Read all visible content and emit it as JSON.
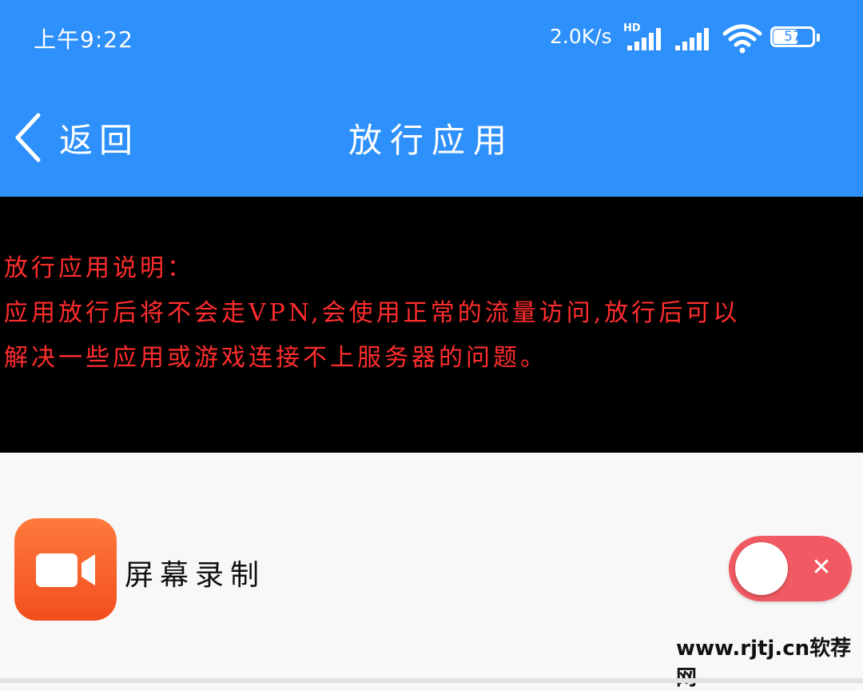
{
  "status_bar": {
    "time": "上午9:22",
    "net_speed": "2.0K/s",
    "network_type": "HD",
    "battery_level": "57"
  },
  "nav": {
    "back_label": "返回",
    "title": "放行应用"
  },
  "notice": {
    "lines": [
      "放行应用说明：",
      "应用放行后将不会走VPN,会使用正常的流量访问,放行后可以",
      "解决一些应用或游戏连接不上服务器的问题。"
    ],
    "text_color": "#ff2d2d"
  },
  "apps": [
    {
      "name": "屏幕录制",
      "icon": "video-camera-icon",
      "bypass_enabled": false
    }
  ],
  "watermark": "www.rjtj.cn软荐网",
  "colors": {
    "header": "#2e90fa",
    "notice_bg": "#000000",
    "toggle_off": "#f25a63",
    "app_icon": "#f5612a"
  }
}
